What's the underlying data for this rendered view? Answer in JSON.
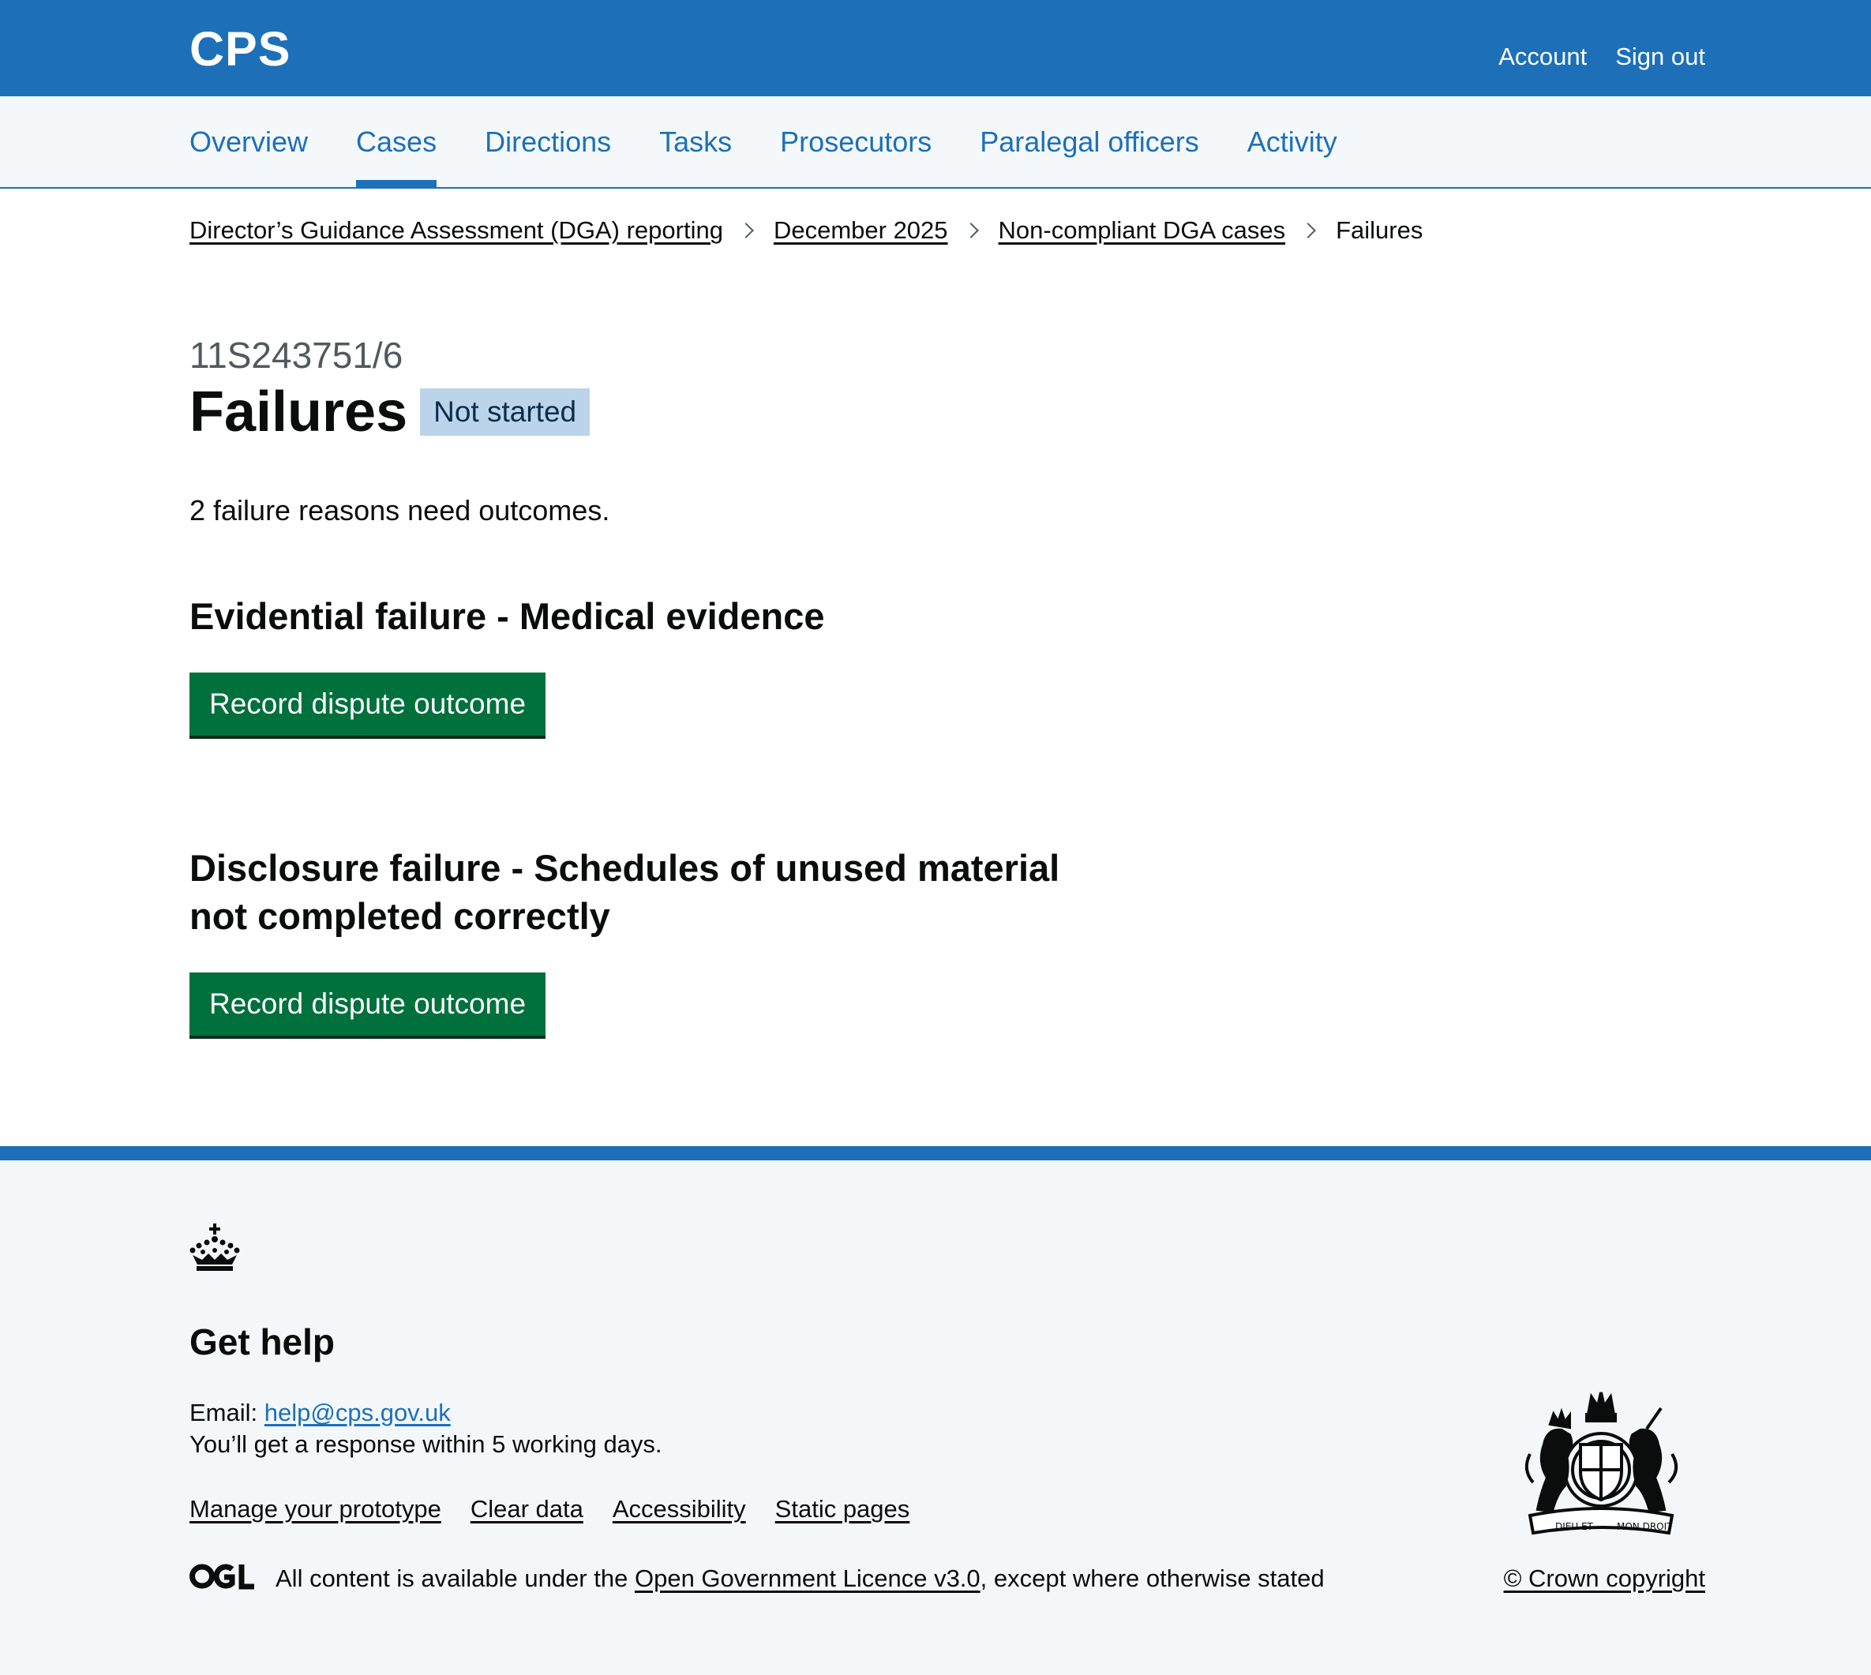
{
  "header": {
    "brand": "CPS",
    "links": [
      "Account",
      "Sign out"
    ]
  },
  "nav": {
    "items": [
      "Overview",
      "Cases",
      "Directions",
      "Tasks",
      "Prosecutors",
      "Paralegal officers",
      "Activity"
    ],
    "active": "Cases"
  },
  "breadcrumb": {
    "items": [
      "Director’s Guidance Assessment (DGA) reporting",
      "December 2025",
      "Non-compliant DGA cases"
    ],
    "current": "Failures"
  },
  "main": {
    "caption": "11S243751/6",
    "title": "Failures",
    "status": "Not started",
    "intro": "2 failure reasons need outcomes.",
    "failures": [
      {
        "heading": "Evidential failure - Medical evidence",
        "button": "Record dispute outcome"
      },
      {
        "heading": "Disclosure failure - Schedules of unused material not completed correctly",
        "button": "Record dispute outcome"
      }
    ]
  },
  "footer": {
    "heading": "Get help",
    "email_label": "Email:",
    "email": "help@cps.gov.uk",
    "response": "You’ll get a response within 5 working days.",
    "links": [
      "Manage your prototype",
      "Clear data",
      "Accessibility",
      "Static pages"
    ],
    "licence_prefix": "All content is available under the",
    "licence_link": "Open Government Licence v3.0",
    "licence_suffix": ", except where otherwise stated",
    "copyright": "© Crown copyright",
    "crest_motto_left": "DIEU ET",
    "crest_motto_right": "MON DROIT"
  },
  "icons": {
    "crown": "crown-icon",
    "ogl": "ogl-logo-icon",
    "crest": "royal-coat-of-arms-icon",
    "chevron": "chevron-right-icon"
  },
  "colors": {
    "brand_blue": "#1d70b8",
    "button_green": "#00703c",
    "tag_bg": "#bbd4ea",
    "footer_bg": "#f3f7fa"
  }
}
